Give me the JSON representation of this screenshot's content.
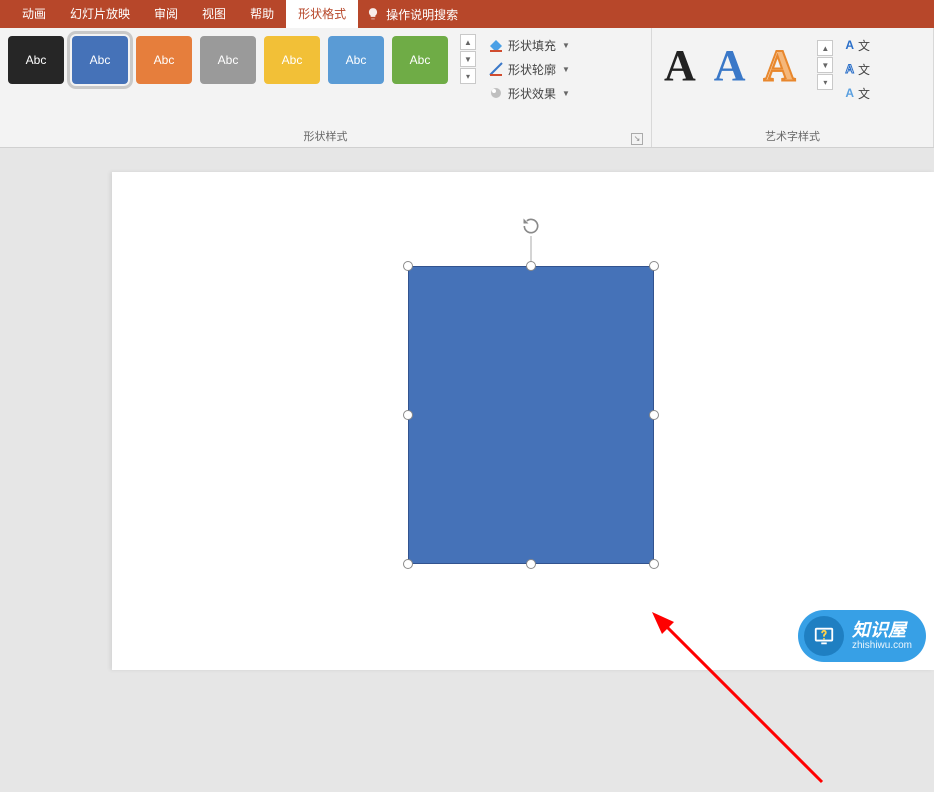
{
  "menubar": {
    "tabs": [
      "动画",
      "幻灯片放映",
      "审阅",
      "视图",
      "帮助",
      "形状格式"
    ],
    "active_index": 5,
    "tell_me": "操作说明搜索"
  },
  "ribbon": {
    "shape_styles": {
      "label": "形状样式",
      "thumbs": [
        {
          "label": "Abc",
          "bg": "#262626"
        },
        {
          "label": "Abc",
          "bg": "#4572b8"
        },
        {
          "label": "Abc",
          "bg": "#e67e3c"
        },
        {
          "label": "Abc",
          "bg": "#9a9a9a"
        },
        {
          "label": "Abc",
          "bg": "#f2c037"
        },
        {
          "label": "Abc",
          "bg": "#5a9bd5"
        },
        {
          "label": "Abc",
          "bg": "#6fac46"
        }
      ],
      "selected_index": 1,
      "options": {
        "fill": "形状填充",
        "outline": "形状轮廓",
        "effects": "形状效果"
      }
    },
    "wordart": {
      "label": "艺术字样式",
      "glyph": "A",
      "text_fill": "文",
      "text_outline": "文",
      "text_effects": "文"
    }
  },
  "watermark": {
    "title": "知识屋",
    "url": "zhishiwu.com"
  }
}
